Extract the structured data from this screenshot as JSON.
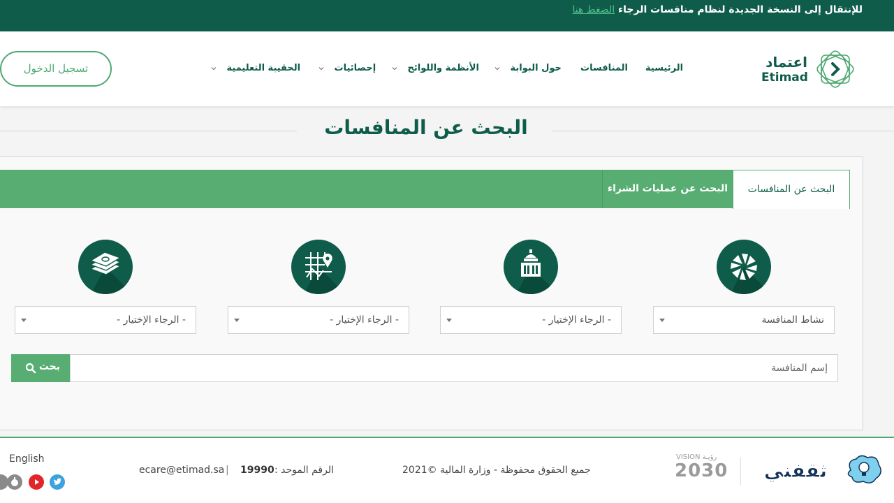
{
  "topbar": {
    "message": "للإنتقال إلى النسخة الجديدة لنظام منافسات الرجاء",
    "link": "الضغط هنا"
  },
  "header": {
    "logo_ar": "اعتماد",
    "logo_en": "Etimad",
    "nav": {
      "home": "الرئيسية",
      "tenders": "المنافسات",
      "about": "حول البوابة",
      "regulations": "الأنظمة واللوائح",
      "statistics": "إحصائيات",
      "training": "الحقيبة التعليمية"
    },
    "login": "تسجيل الدخول"
  },
  "page": {
    "title": "البحث عن المنافسات"
  },
  "tabs": {
    "active": "البحث عن المنافسات",
    "inactive": "البحث عن عمليات الشراء"
  },
  "filters": {
    "activity": {
      "icon": "activity-icon",
      "value": "نشاط المنافسة"
    },
    "agency": {
      "icon": "government-building-icon",
      "value": "- الرجاء الإختيار -"
    },
    "region": {
      "icon": "map-location-icon",
      "value": "- الرجاء الإختيار -"
    },
    "value_range": {
      "icon": "money-icon",
      "value": "- الرجاء الإختيار -"
    }
  },
  "search": {
    "placeholder": "إسم المنافسة",
    "button": "بحث"
  },
  "footer": {
    "language": "English",
    "email": "ecare@etimad.sa",
    "divider": "|",
    "phone_label": "الرقم الموحد :",
    "phone": "19990",
    "copyright": "جميع الحقوق محفوظة - وزارة المالية ©2021",
    "vision_top": "VISION رؤيـة",
    "vision_year": "2030",
    "watermark": "ثقفني"
  },
  "colors": {
    "primary_dark": "#0e5c49",
    "primary_green": "#57ad72",
    "accent_link": "#4fc08d"
  }
}
